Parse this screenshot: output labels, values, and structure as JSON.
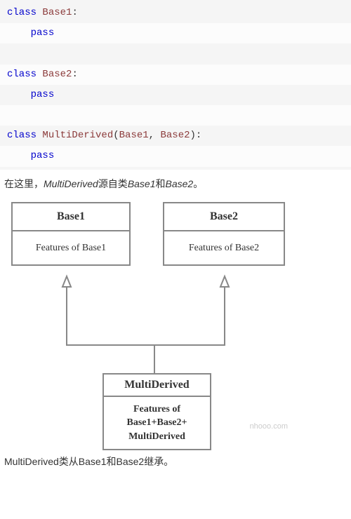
{
  "code": {
    "lines": [
      {
        "tokens": [
          {
            "t": "class ",
            "c": "kw"
          },
          {
            "t": "Base1",
            "c": "cls"
          },
          {
            "t": ":",
            "c": "punct"
          }
        ],
        "alt": false
      },
      {
        "tokens": [
          {
            "t": "    ",
            "c": ""
          },
          {
            "t": "pass",
            "c": "kw"
          }
        ],
        "alt": true
      },
      {
        "tokens": [
          {
            "t": " ",
            "c": ""
          }
        ],
        "alt": false
      },
      {
        "tokens": [
          {
            "t": "class ",
            "c": "kw"
          },
          {
            "t": "Base2",
            "c": "cls"
          },
          {
            "t": ":",
            "c": "punct"
          }
        ],
        "alt": true
      },
      {
        "tokens": [
          {
            "t": "    ",
            "c": ""
          },
          {
            "t": "pass",
            "c": "kw"
          }
        ],
        "alt": false
      },
      {
        "tokens": [
          {
            "t": " ",
            "c": ""
          }
        ],
        "alt": true
      },
      {
        "tokens": [
          {
            "t": "class ",
            "c": "kw"
          },
          {
            "t": "MultiDerived",
            "c": "cls"
          },
          {
            "t": "(",
            "c": "punct"
          },
          {
            "t": "Base1",
            "c": "cls"
          },
          {
            "t": ", ",
            "c": "punct"
          },
          {
            "t": "Base2",
            "c": "cls"
          },
          {
            "t": "):",
            "c": "punct"
          }
        ],
        "alt": false
      },
      {
        "tokens": [
          {
            "t": "    ",
            "c": ""
          },
          {
            "t": "pass",
            "c": "kw"
          }
        ],
        "alt": true
      }
    ]
  },
  "para1": {
    "prefix": "在这里，",
    "em1": "MultiDerived",
    "mid1": "源自类",
    "em2": "Base1",
    "mid2": "和",
    "em3": "Base2",
    "suffix": "。"
  },
  "diagram": {
    "base1": {
      "title": "Base1",
      "body": "Features of Base1"
    },
    "base2": {
      "title": "Base2",
      "body": "Features of Base2"
    },
    "derived": {
      "title": "MultiDerived",
      "body_l1": "Features of",
      "body_l2": "Base1+Base2+",
      "body_l3": "MultiDerived"
    },
    "watermark": "nhooo.com"
  },
  "para2": "MultiDerived类从Base1和Base2继承。"
}
